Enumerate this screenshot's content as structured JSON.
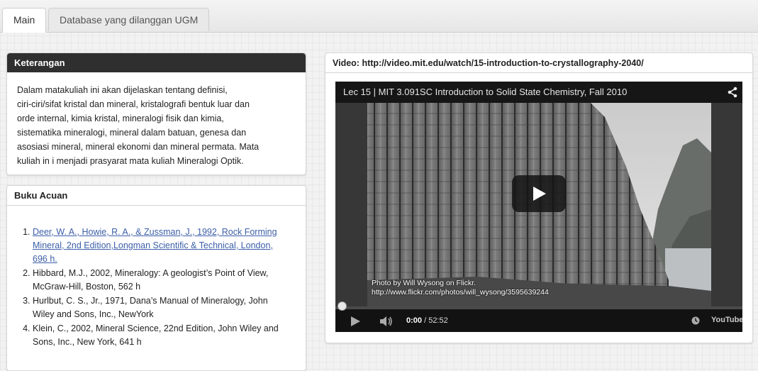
{
  "tabs": [
    {
      "label": "Main",
      "active": true
    },
    {
      "label": "Database yang dilanggan UGM",
      "active": false
    }
  ],
  "keterangan": {
    "title": "Keterangan",
    "lines": [
      "Dalam matakuliah ini akan dijelaskan tentang definisi,",
      "ciri-ciri/sifat kristal dan mineral, kristalografi bentuk luar dan",
      "orde internal, kimia kristal, mineralogi fisik dan kimia,",
      "sistematika mineralogi, mineral dalam batuan, genesa dan",
      "asosiasi mineral, mineral ekonomi dan mineral permata. Mata",
      "kuliah in i menjadi prasyarat mata kuliah Mineralogi Optik."
    ]
  },
  "buku": {
    "title": "Buku Acuan",
    "items": [
      "Deer, W. A., Howie, R. A., & Zussman, J., 1992, Rock Forming Mineral, 2nd Edition,Longman Scientific & Technical, London, 696 h.",
      "Hibbard, M.J., 2002, Mineralogy: A geologist’s Point of View, McGraw-Hill, Boston, 562 h",
      "Hurlbut, C. S., Jr., 1971, Dana’s Manual of Mineralogy, John Wiley and Sons, Inc., NewYork",
      "Klein, C., 2002, Mineral Science, 22nd Edition, John Wiley and Sons, Inc., New York, 641 h"
    ]
  },
  "video": {
    "heading": "Video: http://video.mit.edu/watch/15-introduction-to-crystallography-2040/",
    "title": "Lec 15 | MIT 3.091SC Introduction to Solid State Chemistry, Fall 2010",
    "credit_line1": "Photo by Will Wysong on Flickr.",
    "credit_line2": "http://www.flickr.com/photos/will_wysong/3595639244",
    "time_current": "0:00",
    "time_total": " / 52:52",
    "progress": 0,
    "youtube_label": "YouTube"
  }
}
